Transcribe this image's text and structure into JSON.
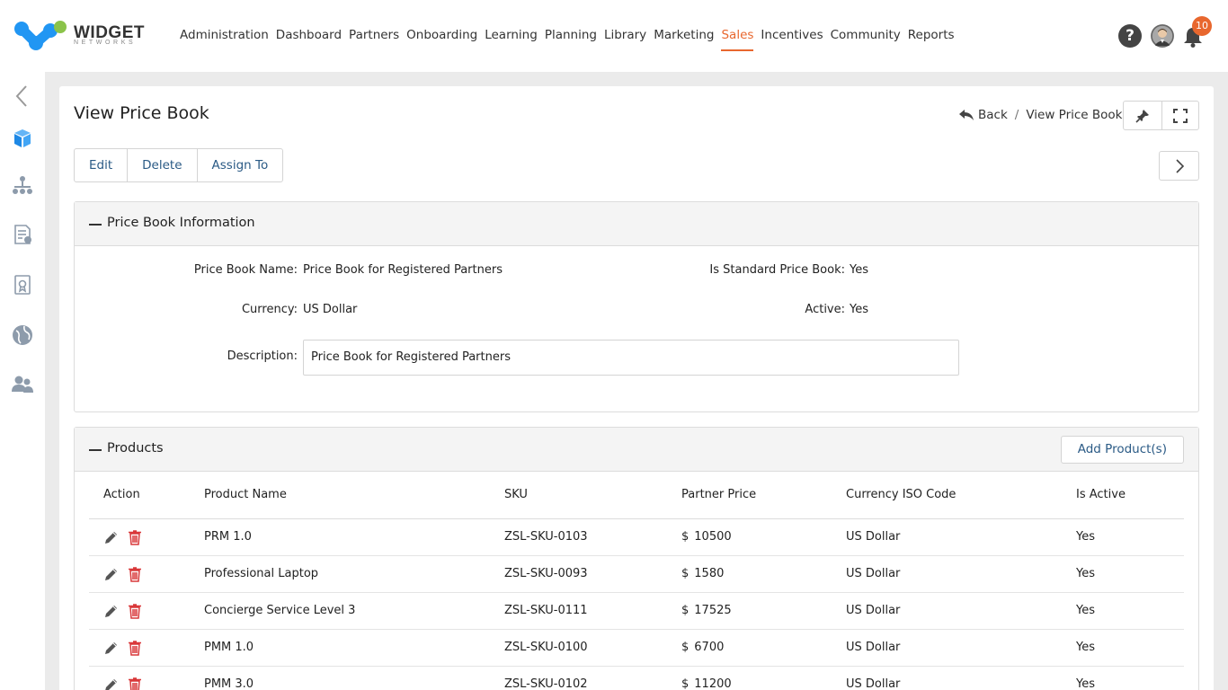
{
  "brand": {
    "name": "WIDGET",
    "tagline": "NETWORKS",
    "accent": "#e8672e",
    "logo_blue": "#2196f3",
    "logo_green": "#8bc34a"
  },
  "nav": {
    "items": [
      {
        "label": "Administration"
      },
      {
        "label": "Dashboard"
      },
      {
        "label": "Partners"
      },
      {
        "label": "Onboarding"
      },
      {
        "label": "Learning"
      },
      {
        "label": "Planning"
      },
      {
        "label": "Library"
      },
      {
        "label": "Marketing"
      },
      {
        "label": "Sales",
        "active": true
      },
      {
        "label": "Incentives"
      },
      {
        "label": "Community"
      },
      {
        "label": "Reports"
      }
    ],
    "notification_count": "10",
    "help_icon": "question-circle-icon",
    "user_icon": "user-avatar-icon",
    "bell_icon": "bell-icon"
  },
  "rail": {
    "icons": [
      "collapse-chevron-icon",
      "cubes-icon",
      "org-chart-icon",
      "invoice-icon",
      "certificate-icon",
      "globe-icon",
      "users-icon"
    ]
  },
  "page": {
    "title": "View Price Book",
    "back_label": "Back",
    "breadcrumb_separator": "/",
    "breadcrumb_current": "View Price Book",
    "actions": {
      "edit": "Edit",
      "delete": "Delete",
      "assign_to": "Assign To"
    }
  },
  "info": {
    "section_title": "Price Book Information",
    "name_label": "Price Book Name:",
    "name_value": "Price Book for Registered Partners",
    "standard_label": "Is Standard Price Book:",
    "standard_value": "Yes",
    "currency_label": "Currency:",
    "currency_value": "US Dollar",
    "active_label": "Active:",
    "active_value": "Yes",
    "description_label": "Description:",
    "description_value": "Price Book for Registered Partners"
  },
  "products": {
    "section_title": "Products",
    "add_button": "Add Product(s)",
    "columns": [
      "Action",
      "Product Name",
      "SKU",
      "Partner Price",
      "Currency ISO Code",
      "Is Active"
    ],
    "rows": [
      {
        "name": "PRM 1.0",
        "sku": "ZSL-SKU-0103",
        "currency_symbol": "$",
        "price": "10500",
        "currency": "US Dollar",
        "active": "Yes"
      },
      {
        "name": "Professional Laptop",
        "sku": "ZSL-SKU-0093",
        "currency_symbol": "$",
        "price": "1580",
        "currency": "US Dollar",
        "active": "Yes"
      },
      {
        "name": "Concierge Service Level 3",
        "sku": "ZSL-SKU-0111",
        "currency_symbol": "$",
        "price": "17525",
        "currency": "US Dollar",
        "active": "Yes"
      },
      {
        "name": "PMM 1.0",
        "sku": "ZSL-SKU-0100",
        "currency_symbol": "$",
        "price": "6700",
        "currency": "US Dollar",
        "active": "Yes"
      },
      {
        "name": "PMM 3.0",
        "sku": "ZSL-SKU-0102",
        "currency_symbol": "$",
        "price": "11200",
        "currency": "US Dollar",
        "active": "Yes"
      }
    ]
  }
}
